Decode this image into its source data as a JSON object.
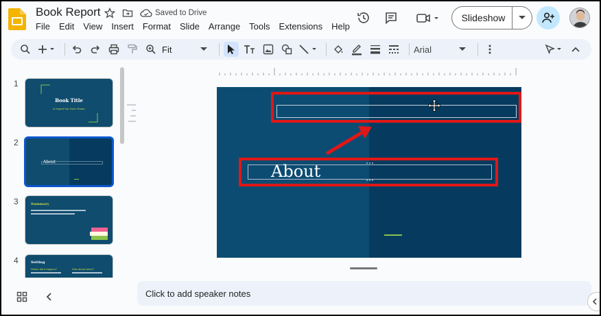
{
  "app": {
    "doc_title": "Book Report",
    "saved_status": "Saved to Drive",
    "menu": [
      "File",
      "Edit",
      "View",
      "Insert",
      "Format",
      "Slide",
      "Arrange",
      "Tools",
      "Extensions",
      "Help"
    ],
    "slideshow_label": "Slideshow"
  },
  "toolbar": {
    "zoom_value": "Fit",
    "font_value": "Arial"
  },
  "slides": [
    {
      "number": "1",
      "title": "Book Title",
      "subtitle": "A report by Your Name"
    },
    {
      "number": "2",
      "title": "About"
    },
    {
      "number": "3",
      "title": "Summary"
    },
    {
      "number": "4",
      "title": "Setting",
      "col1": "Where did it happen?",
      "col2": "How about when?"
    }
  ],
  "editor": {
    "slide_text": "About"
  },
  "notes": {
    "placeholder": "Click to add speaker notes"
  },
  "colors": {
    "slide_bg": "#0d4c72",
    "slide_bg_dark": "#063b5f",
    "highlight": "#e01717",
    "accent_green": "#8bc34a",
    "active_blue": "#0b57d0"
  },
  "icons": [
    "slides-logo-icon",
    "star-icon",
    "move-folder-icon",
    "cloud-saved-icon",
    "history-icon",
    "comment-icon",
    "meet-icon",
    "share-icon",
    "search-icon",
    "plus-icon",
    "undo-icon",
    "redo-icon",
    "print-icon",
    "paint-format-icon",
    "zoom-icon",
    "select-icon",
    "text-box-icon",
    "image-icon",
    "shape-icon",
    "line-icon",
    "fill-color-icon",
    "border-color-icon",
    "border-weight-icon",
    "border-dash-icon",
    "more-icon",
    "pointer-icon",
    "collapse-icon",
    "grid-view-icon",
    "chevron-left-icon"
  ]
}
